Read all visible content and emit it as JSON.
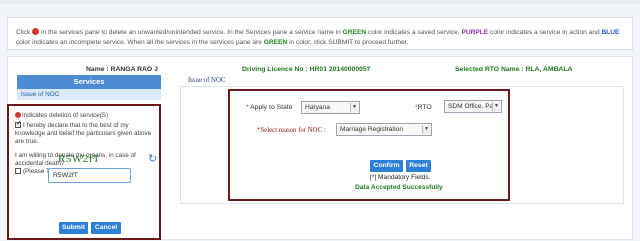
{
  "info": {
    "text_1": "Click",
    "text_2": "in the services pane to delete an unwanted/unintended service. In the Services pane a service name in",
    "green": "GREEN",
    "text_3": "color indicates a saved service,",
    "purple": "PURPLE",
    "text_4": "color indicates a service in action and",
    "blue": "BLUE",
    "text_5": "color indicates an incomplete service. When all the services in the services pane are",
    "green2": "GREEN",
    "text_6": "in color, click SUBMIT to proceed further."
  },
  "header": {
    "name": "Name : RANGA RAO J",
    "dl": "Driving Licence No : HR01 20140000057",
    "rto": "Selected RTO Name : RLA, AMBALA"
  },
  "services": {
    "title": "Services",
    "items": [
      "Issue of NOC"
    ]
  },
  "main": {
    "issue_label": "Issue of NOC"
  },
  "left": {
    "deletion_note": "Indicates deletion of service(S)",
    "declaration": "I hereby declare that to the best of my knowledge and belief the particulars given above are true.",
    "organ_q": "I am willing to donate my organs, in case of accidental death?",
    "tick_label": "(Please Tick if willing)",
    "captcha": "R5W2fT",
    "captcha_input": "R5W2fT",
    "submit": "Submit",
    "cancel": "Cancel"
  },
  "form": {
    "state_label": "Apply to State",
    "state_value": "Haryana",
    "rto_label": "RTO",
    "rto_value": "SDM Office, Par",
    "reason_label": "Select reason for NOC :",
    "reason_value": "Marriage Registration",
    "confirm": "Confirm",
    "reset": "Reset",
    "mandatory": "[*] Mandatory Fields.",
    "accepted": "Data Accepted Successfully"
  }
}
